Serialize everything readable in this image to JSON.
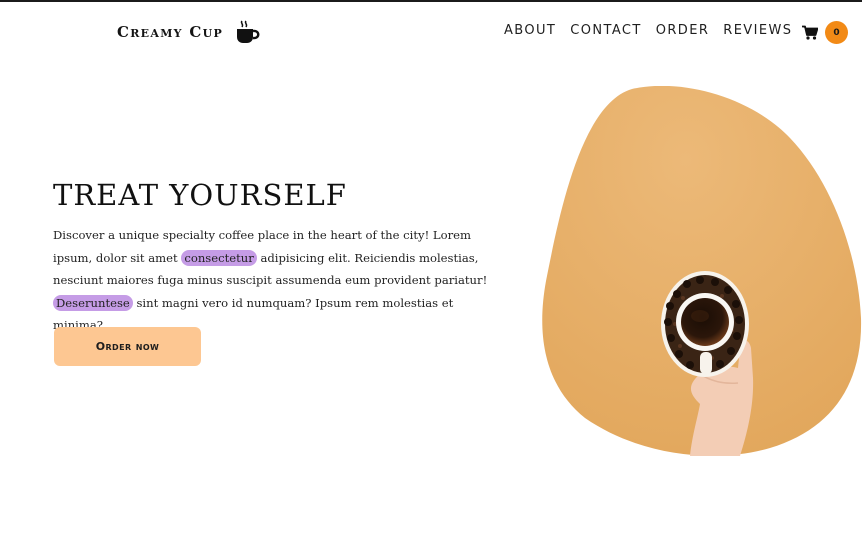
{
  "brand": {
    "name": "Creamy Cup",
    "icon": "coffee-cup-icon"
  },
  "nav": {
    "items": [
      "ABOUT",
      "CONTACT",
      "ORDER",
      "REVIEWS"
    ]
  },
  "cart": {
    "icon": "shopping-cart-icon",
    "count": "0",
    "badge_color": "#f28a16"
  },
  "hero": {
    "title": "TREAT YOURSELF",
    "text_parts": [
      "Discover a unique specialty coffee place in the heart of the city! Lorem ipsum, dolor sit amet ",
      "consectetur",
      " adipisicing elit. Reiciendis molestias, nesciunt maiores fuga minus suscipit assumenda eum provident pariatur! ",
      "Deseruntese",
      " sint magni vero id numquam? Ipsum rem molestias et minima?"
    ],
    "highlight_color": "#c59ce6",
    "button_label": "Order now",
    "button_color": "#fdc792",
    "image_background": "#e9b36d"
  }
}
